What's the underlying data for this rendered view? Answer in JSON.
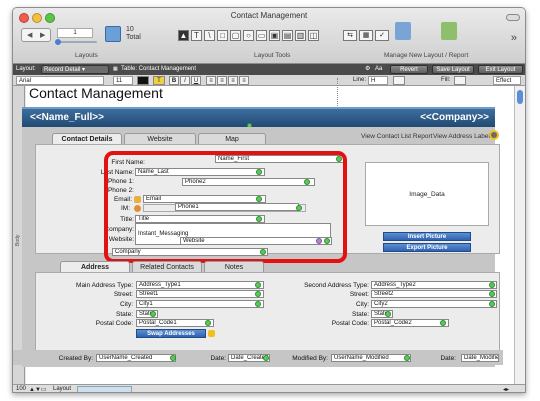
{
  "window": {
    "title": "Contact Management",
    "traffic_colors": [
      "#f05a4f",
      "#f5bf3f",
      "#5cc547"
    ]
  },
  "toolbar": {
    "record_number": "1",
    "total_count": "10",
    "total_label": "Total",
    "layouts_label": "Layouts",
    "layout_tools_label": "Layout Tools",
    "manage_label": "Manage",
    "new_layout_label": "New Layout / Report",
    "tool_glyphs": [
      "T",
      "\\",
      "□",
      "▢",
      "○"
    ]
  },
  "layoutbar": {
    "layout_label": "Layout:",
    "layout_value": "Record Detail",
    "table_label": "Table: Contact Management",
    "aa_label": "Aa",
    "revert_label": "Revert",
    "save_label": "Save Layout",
    "exit_label": "Exit Layout"
  },
  "formatbar": {
    "font": "Arial",
    "size": "11",
    "bold": "B",
    "italic": "I",
    "underline": "U",
    "line_label": "Line:",
    "line_value": "H",
    "fill_label": "Fill:",
    "effect_value": "Effect"
  },
  "side_label": "Body",
  "page_title": "Contact Management",
  "header": {
    "name_field": "<<Name_Full>>",
    "company_field": "<<Company>>"
  },
  "tabs": [
    "Contact Details",
    "Website",
    "Map"
  ],
  "header_links": {
    "list_report": "View Contact List Report",
    "address_labels": "View Address Labels"
  },
  "contact_fields": {
    "first_name_label": "First Name:",
    "first_name_value": "Name_First",
    "last_name_label": "Last Name:",
    "last_name_value": "Name_Last",
    "phone1_label": "Phone 1:",
    "phone1_value": "Phone2",
    "phone2_label": "Phone 2:",
    "email_label": "Email:",
    "email_value": "Email",
    "im_label": "IM:",
    "im_value": "Phone1",
    "title_label": "Title:",
    "title_value": "Title",
    "company_label": "Company:",
    "im_field_value": "Instant_Messaging",
    "website_label": "Website:",
    "website_value": "Website",
    "company_value": "Company"
  },
  "image_box": "Image_Data",
  "insert_picture": "Insert Picture",
  "export_picture": "Export Picture",
  "lower_tabs": [
    "Address",
    "Related Contacts",
    "Notes"
  ],
  "address": {
    "main_type_label": "Main Address Type:",
    "main_type_value": "Address_Type1",
    "street_label": "Street:",
    "street1_value": "Street1",
    "city_label": "City:",
    "city1_value": "City1",
    "state_label": "State:",
    "state1_value": "State",
    "postal_label": "Postal Code:",
    "postal1_value": "Postal_Code1",
    "second_type_label": "Second Address Type:",
    "second_type_value": "Address_Type2",
    "street2_value": "Street2",
    "city2_value": "City2",
    "state2_value": "State",
    "postal2_value": "Postal_Code2",
    "swap_label": "Swap Addresses"
  },
  "footer": {
    "created_by_label": "Created By:",
    "created_by_value": "UserName_Created",
    "date_label": "Date:",
    "date_created_value": "Date_Created",
    "modified_by_label": "Modified By:",
    "modified_by_value": "UserName_Modified",
    "date_modified_value": "Date_Modified"
  },
  "status": {
    "zoom": "100",
    "mode": "Layout"
  },
  "colors": {
    "header_blue": "#2d5b8a",
    "highlight_red": "#e21212",
    "button_blue": "#3a6fbf"
  }
}
